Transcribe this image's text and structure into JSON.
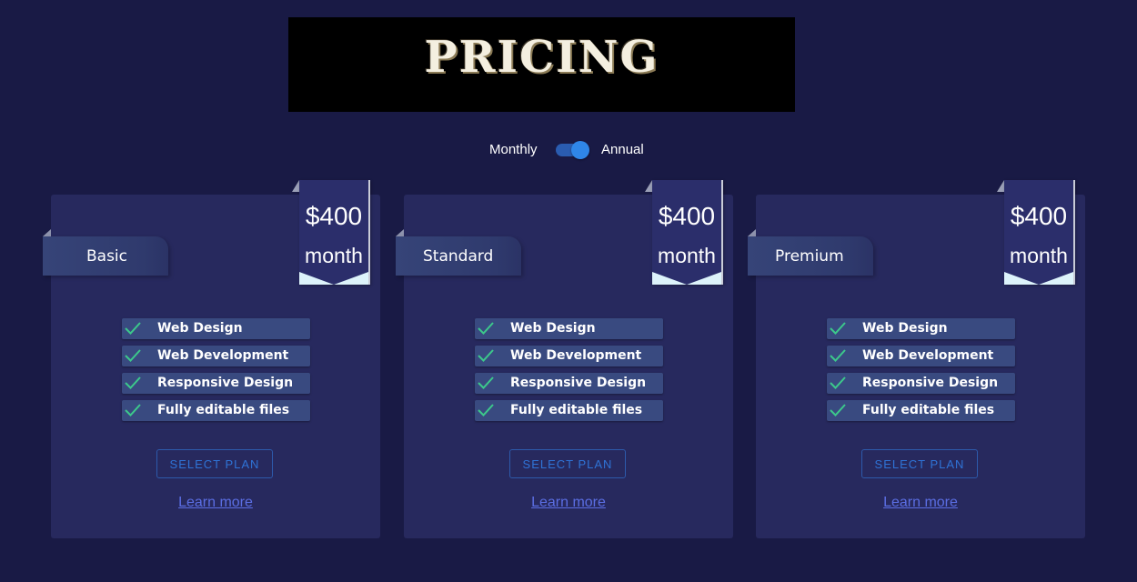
{
  "header": {
    "title": "PRICING"
  },
  "billing_toggle": {
    "monthly_label": "Monthly",
    "annual_label": "Annual",
    "selected": "Annual"
  },
  "colors": {
    "background": "#191a45",
    "card": "#27295e",
    "feature_bg": "#394a80",
    "check": "#3cc98b",
    "button": "#2f73d6",
    "link": "#5b6ee3"
  },
  "plans": [
    {
      "name": "Basic",
      "price": "$400",
      "period": "month",
      "features": [
        "Web Design",
        "Web Development",
        "Responsive Design",
        "Fully editable files"
      ],
      "button_label": "SELECT PLAN",
      "link_label": "Learn more"
    },
    {
      "name": "Standard",
      "price": "$400",
      "period": "month",
      "features": [
        "Web Design",
        "Web Development",
        "Responsive Design",
        "Fully editable files"
      ],
      "button_label": "SELECT PLAN",
      "link_label": "Learn more"
    },
    {
      "name": "Premium",
      "price": "$400",
      "period": "month",
      "features": [
        "Web Design",
        "Web Development",
        "Responsive Design",
        "Fully editable files"
      ],
      "button_label": "SELECT PLAN",
      "link_label": "Learn more"
    }
  ]
}
